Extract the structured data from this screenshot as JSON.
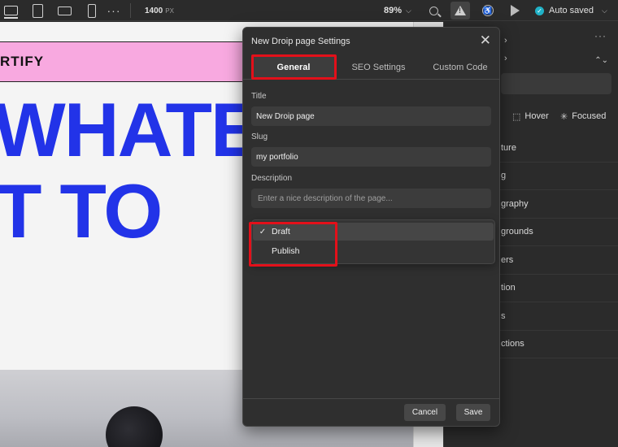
{
  "toolbar": {
    "device_icons": [
      "desktop-icon",
      "tablet-icon",
      "tablet-landscape-icon",
      "mobile-icon"
    ],
    "more_icon": "more-icon",
    "width_value": "1400",
    "width_unit": "PX",
    "zoom": "89%",
    "zoom_chevron": "⌵",
    "autosave_label": "Auto saved",
    "autosave_check": "✓",
    "autosave_chevron": "⌵"
  },
  "canvas": {
    "logo_text": "RTIFY",
    "hero_line_1": "WHATEV",
    "hero_line_2": "T TO"
  },
  "right_panel": {
    "more": "···",
    "selector_chevron": "⌃⌄",
    "state_hover": "Hover",
    "state_focused": "Focused",
    "partial_state": "l",
    "items": [
      "ture",
      "g",
      "graphy",
      "grounds",
      "ers",
      "tion",
      "s",
      "ctions"
    ]
  },
  "modal": {
    "title": "New Droip page Settings",
    "close": "✕",
    "tabs": [
      "General",
      "SEO Settings",
      "Custom Code"
    ],
    "active_tab": "General",
    "title_label": "Title",
    "title_value": "New Droip page",
    "slug_label": "Slug",
    "slug_value": "my portfolio",
    "description_label": "Description",
    "description_placeholder": "Enter a nice description of the page...",
    "status_options": [
      "Draft",
      "Publish"
    ],
    "status_selected": "Draft",
    "check": "✓",
    "cancel_label": "Cancel",
    "save_label": "Save",
    "side_chevron": "›"
  },
  "colors": {
    "highlight": "#e3101a",
    "hero_text": "#2233e8",
    "header_bg": "#f8a9e0",
    "autosave_dot": "#20b2c7"
  }
}
